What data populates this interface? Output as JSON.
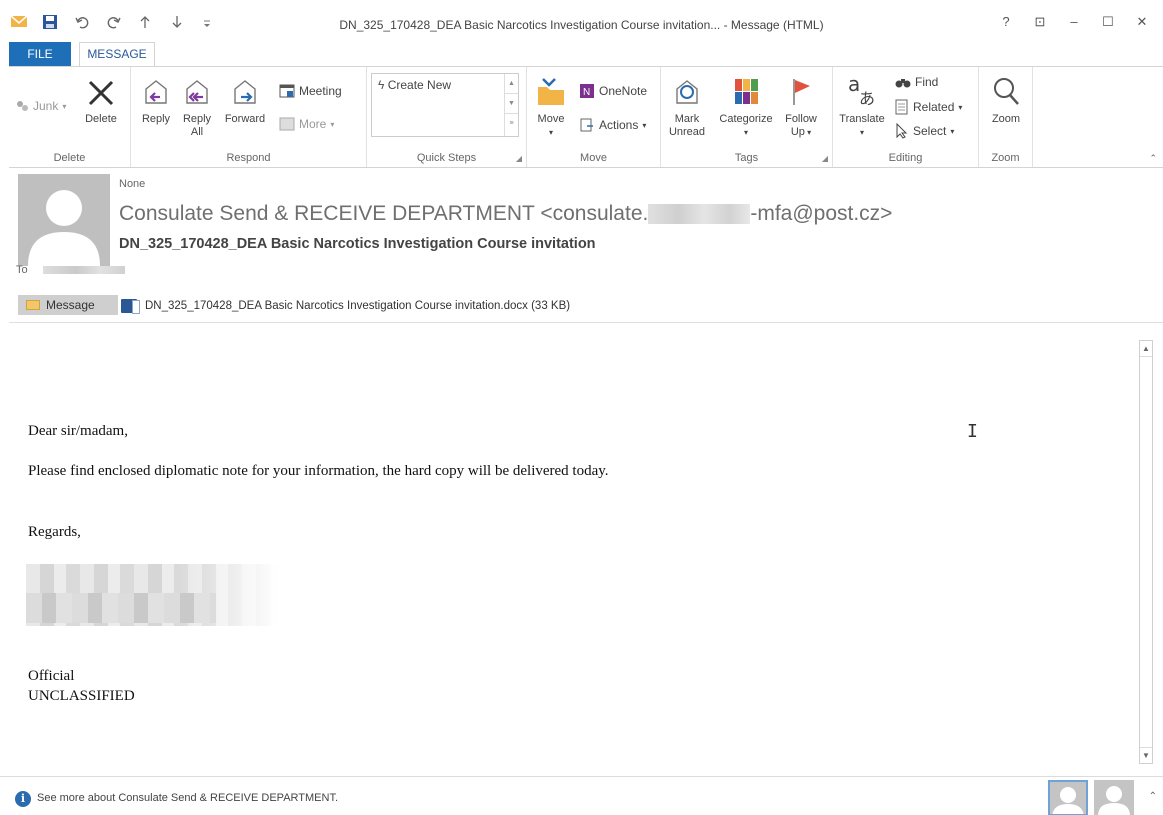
{
  "window": {
    "title": "DN_325_170428_DEA Basic Narcotics Investigation Course invitation... - Message (HTML)",
    "controls": [
      "?",
      "⊡",
      "–",
      "☐",
      "✕"
    ]
  },
  "qat": {
    "icons": [
      "mail-icon",
      "save-icon",
      "undo-icon",
      "redo-icon",
      "up-arrow-icon",
      "down-arrow-icon",
      "customize-icon"
    ]
  },
  "tabs": {
    "file": "FILE",
    "message": "MESSAGE"
  },
  "ribbon": {
    "delete_group": {
      "label": "Delete",
      "junk": "Junk",
      "delete": "Delete"
    },
    "respond_group": {
      "label": "Respond",
      "reply": "Reply",
      "reply_all_1": "Reply",
      "reply_all_2": "All",
      "forward": "Forward",
      "meeting": "Meeting",
      "more": "More"
    },
    "quicksteps_group": {
      "label": "Quick Steps",
      "create_new": "Create New"
    },
    "move_group": {
      "label": "Move",
      "move": "Move",
      "onenote": "OneNote",
      "actions": "Actions"
    },
    "tags_group": {
      "label": "Tags",
      "mark_1": "Mark",
      "mark_2": "Unread",
      "categorize": "Categorize",
      "follow_1": "Follow",
      "follow_2": "Up"
    },
    "editing_group": {
      "label": "Editing",
      "translate": "Translate",
      "find": "Find",
      "related": "Related",
      "select": "Select"
    },
    "zoom_group": {
      "label": "Zoom",
      "zoom": "Zoom"
    },
    "colors": {
      "accent": "#2b579a",
      "file_tab": "#1e6fb8",
      "flag": "#e0533c"
    }
  },
  "header": {
    "importance": "None",
    "sender_prefix": "Consulate Send & RECEIVE DEPARTMENT <consulate.",
    "sender_suffix": "-mfa@post.cz>",
    "subject": "DN_325_170428_DEA Basic Narcotics Investigation Course invitation",
    "to_label": "To"
  },
  "attachments": {
    "message_tab": "Message",
    "file": "DN_325_170428_DEA Basic Narcotics Investigation Course invitation.docx (33 KB)"
  },
  "body": {
    "greeting": "Dear sir/madam,",
    "line1": "Please find enclosed diplomatic note for your information, the hard copy will be delivered today.",
    "regards": "Regards,",
    "official": "Official",
    "classification": "UNCLASSIFIED"
  },
  "people_pane": {
    "text": "See more about Consulate Send & RECEIVE DEPARTMENT."
  }
}
